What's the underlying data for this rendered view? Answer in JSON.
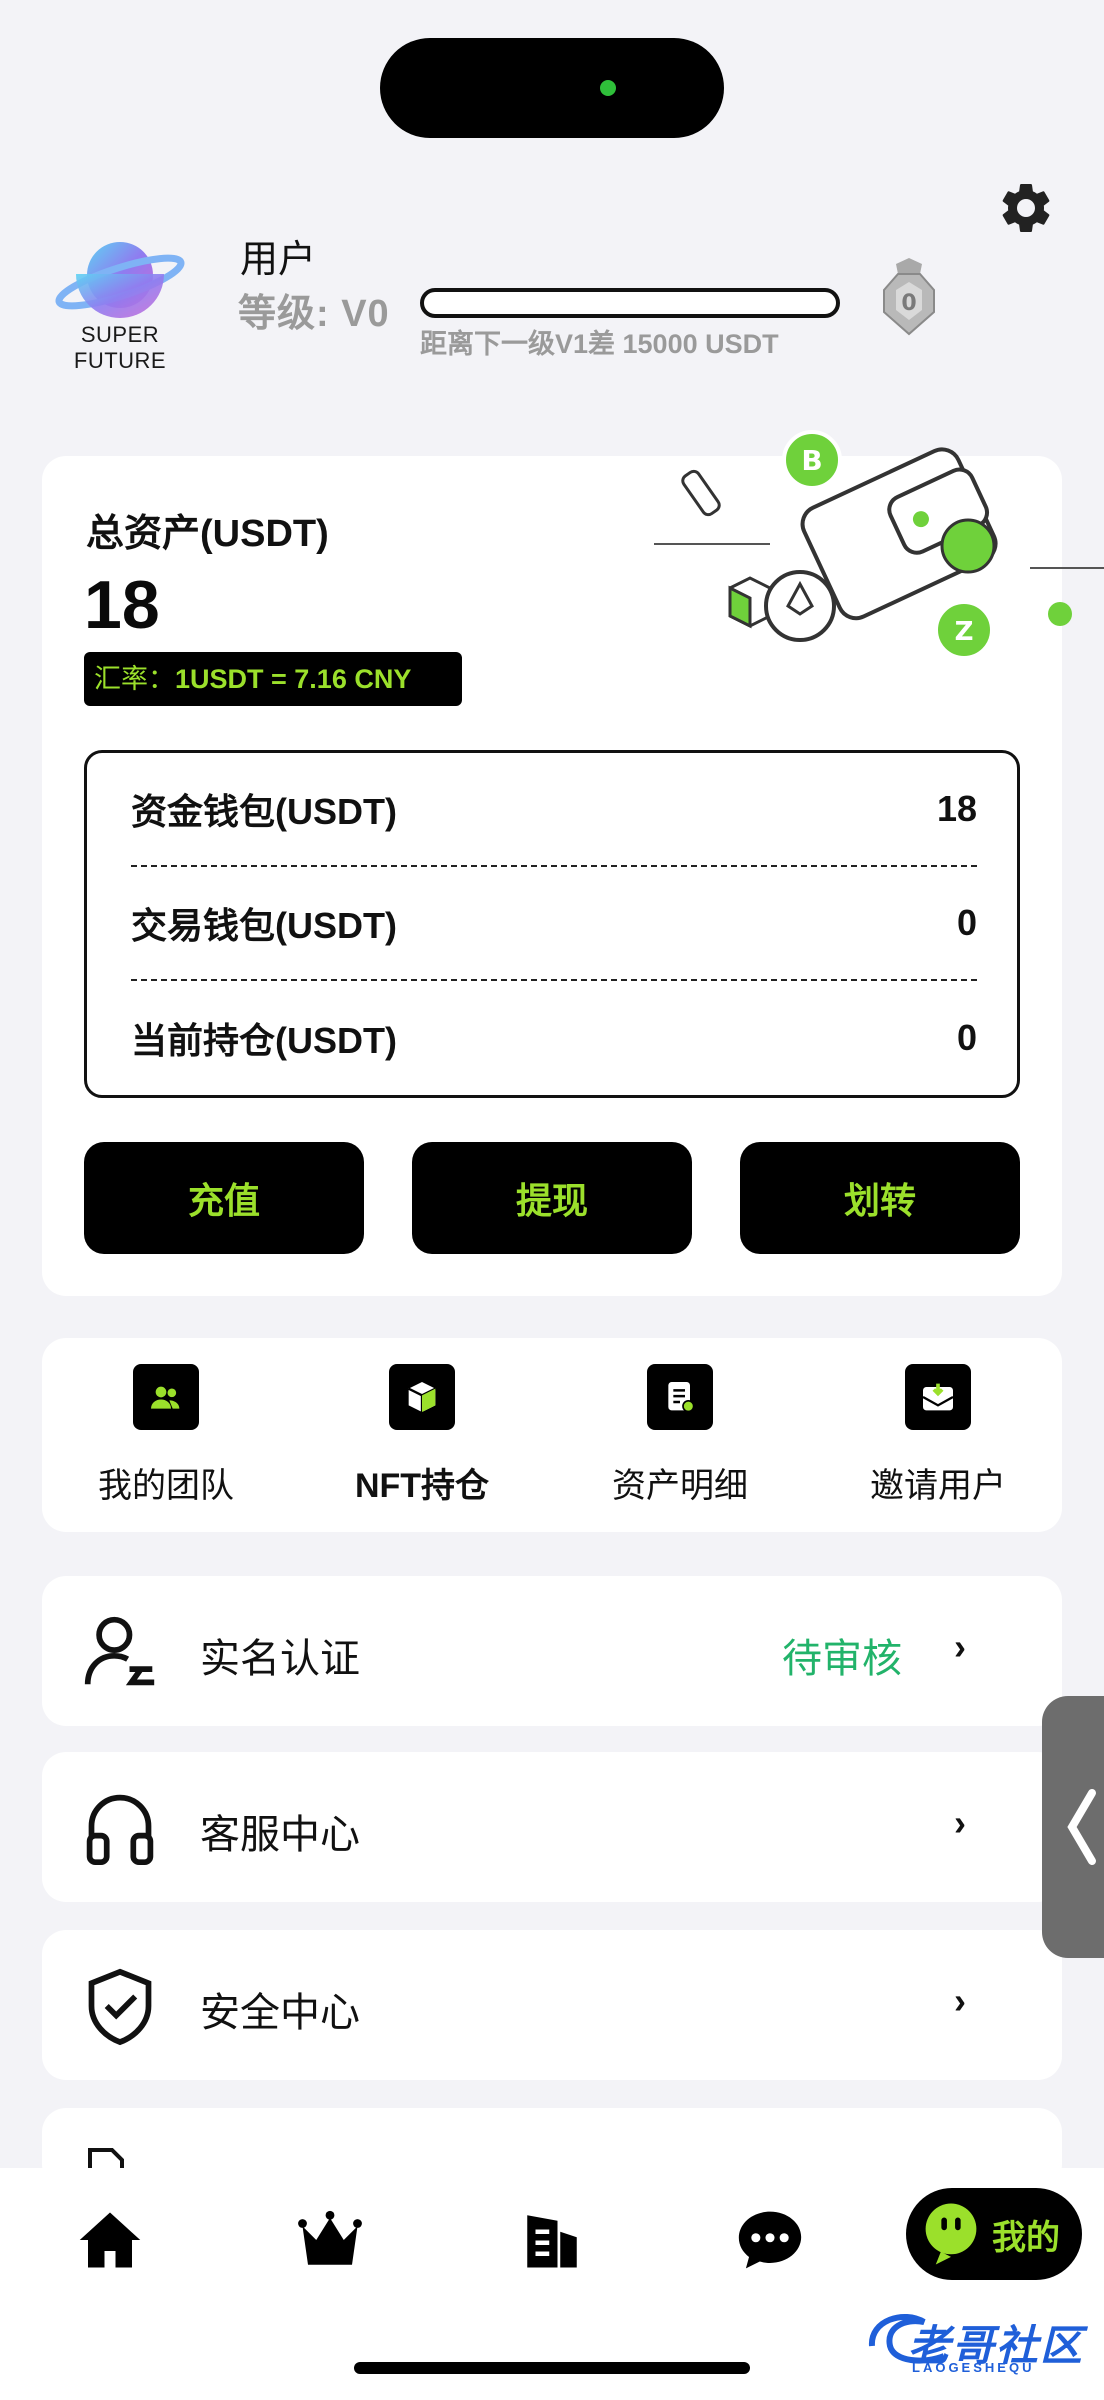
{
  "header": {
    "logo_text": "SUPER FUTURE",
    "username": "用户",
    "level_text": "等级: V0",
    "progress": 0,
    "next_level_text": "距离下一级V1差 15000 USDT",
    "badge_value": "0"
  },
  "assets": {
    "total_label": "总资产(USDT)",
    "total_value": "18",
    "rate_label": "汇率：",
    "rate_value": "1USDT = 7.16 CNY",
    "wallets": [
      {
        "label": "资金钱包(USDT)",
        "value": "18"
      },
      {
        "label": "交易钱包(USDT)",
        "value": "0"
      },
      {
        "label": "当前持仓(USDT)",
        "value": "0"
      }
    ],
    "buttons": {
      "deposit": "充值",
      "withdraw": "提现",
      "transfer": "划转"
    }
  },
  "quick_actions": [
    {
      "label": "我的团队",
      "icon": "team-icon"
    },
    {
      "label": "NFT持仓",
      "icon": "cube-icon"
    },
    {
      "label": "资产明细",
      "icon": "document-list-icon"
    },
    {
      "label": "邀请用户",
      "icon": "invite-envelope-icon"
    }
  ],
  "menu": [
    {
      "label": "实名认证",
      "status": "待审核",
      "icon": "user-verify-icon"
    },
    {
      "label": "客服中心",
      "status": "",
      "icon": "headphones-icon"
    },
    {
      "label": "安全中心",
      "status": "",
      "icon": "shield-check-icon"
    }
  ],
  "chevron": "›",
  "nav": {
    "items": [
      "home-icon",
      "crown-icon",
      "building-icon",
      "chat-icon"
    ],
    "active_label": "我的"
  },
  "watermark": {
    "main": "老哥社区",
    "sub": "LAOGESHEQU"
  },
  "colors": {
    "accent": "#9be02b",
    "status": "#22b36a",
    "background": "#f3f3f7"
  }
}
